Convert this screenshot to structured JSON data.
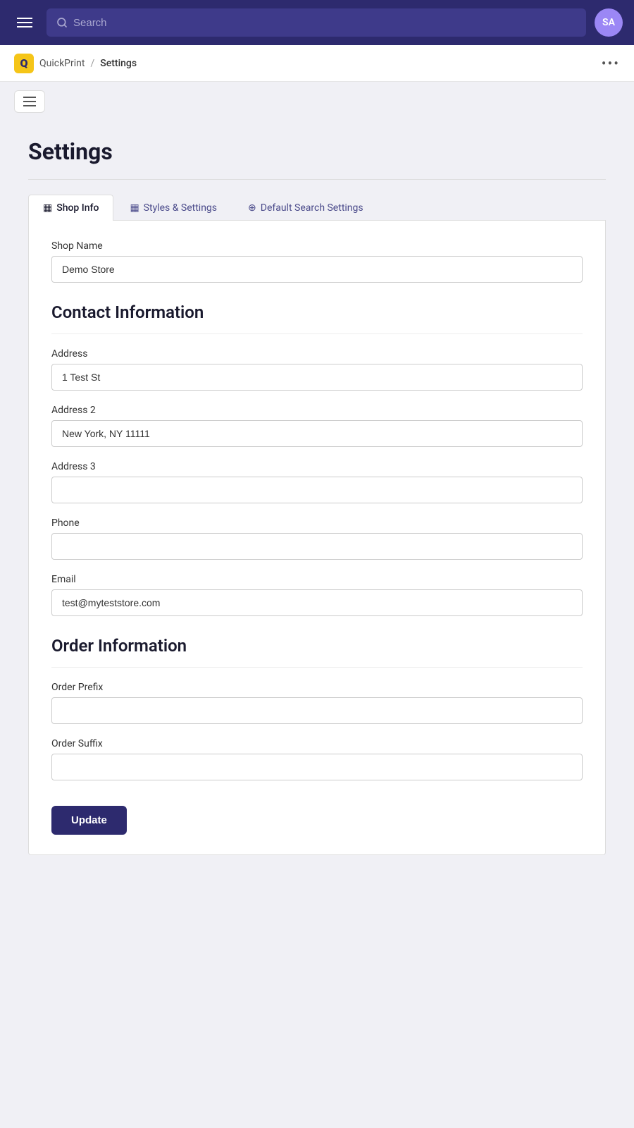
{
  "topbar": {
    "search_placeholder": "Search",
    "avatar_initials": "SA",
    "avatar_bg": "#9b87f5"
  },
  "breadcrumb": {
    "logo_letter": "Q",
    "app_name": "QuickPrint",
    "separator": "/",
    "current_page": "Settings",
    "more_icon": "•••"
  },
  "page": {
    "title": "Settings"
  },
  "tabs": [
    {
      "id": "shop-info",
      "label": "Shop Info",
      "icon": "▦",
      "active": true
    },
    {
      "id": "styles-settings",
      "label": "Styles & Settings",
      "icon": "▦",
      "active": false
    },
    {
      "id": "default-search",
      "label": "Default Search Settings",
      "icon": "⊕",
      "active": false
    }
  ],
  "shop_info": {
    "shop_name_label": "Shop Name",
    "shop_name_value": "Demo Store",
    "contact_section_title": "Contact Information",
    "address_label": "Address",
    "address_value": "1 Test St",
    "address2_label": "Address 2",
    "address2_value": "New York, NY 11111",
    "address3_label": "Address 3",
    "address3_value": "",
    "phone_label": "Phone",
    "phone_value": "",
    "email_label": "Email",
    "email_value": "test@myteststore.com",
    "order_section_title": "Order Information",
    "order_prefix_label": "Order Prefix",
    "order_prefix_value": "",
    "order_suffix_label": "Order Suffix",
    "order_suffix_value": "",
    "update_button_label": "Update"
  }
}
